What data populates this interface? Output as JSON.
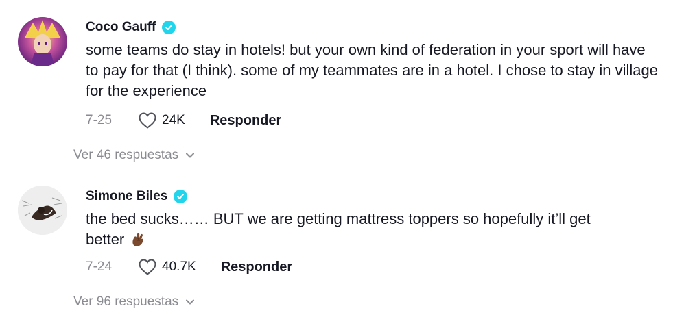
{
  "comments": [
    {
      "author": "Coco Gauff",
      "verified": true,
      "text": "some teams do stay in hotels! but your own kind of federation in your sport will have to pay for that (I think). some of my teammates are in a hotel. I chose to stay in village for the experience",
      "date": "7-25",
      "likes": "24K",
      "reply_label": "Responder",
      "view_replies_label": "Ver 46 respuestas"
    },
    {
      "author": "Simone Biles",
      "verified": true,
      "text": "the bed sucks…… BUT we are getting mattress toppers so hopefully it’ll get better",
      "emoji": "crossed-fingers-icon",
      "date": "7-24",
      "likes": "40.7K",
      "reply_label": "Responder",
      "view_replies_label": "Ver 96 respuestas"
    }
  ],
  "colors": {
    "text_primary": "#161823",
    "text_secondary": "#8a8b91",
    "verified_badge": "#20d5ec"
  }
}
